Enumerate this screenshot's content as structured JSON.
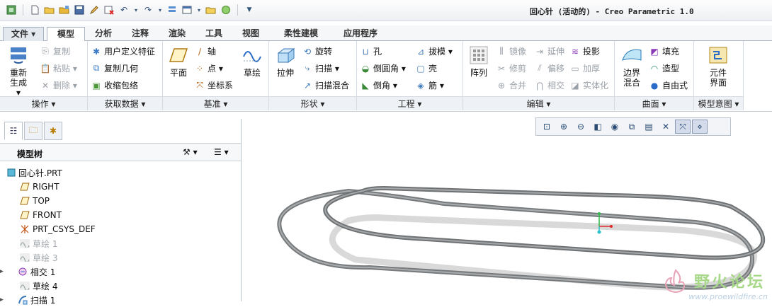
{
  "window": {
    "title": "回心针 (活动的) - Creo Parametric 1.0"
  },
  "quick_access": [
    "app-icon",
    "new-icon",
    "open-icon",
    "open-folder-icon",
    "save-icon",
    "edit-icon",
    "close-window-icon",
    "undo-icon",
    "redo-icon",
    "regenerate-icon",
    "windows-icon",
    "folder-icon",
    "sphere-icon",
    "customize-icon"
  ],
  "tabs": [
    {
      "label": "文件 ▾"
    },
    {
      "label": "模型"
    },
    {
      "label": "分析"
    },
    {
      "label": "注释"
    },
    {
      "label": "渲染"
    },
    {
      "label": "工具"
    },
    {
      "label": "视图"
    },
    {
      "label": "柔性建模"
    },
    {
      "label": "应用程序"
    }
  ],
  "ribbon": {
    "ops": {
      "regen": "重新生成 ▾",
      "copy": "复制",
      "paste": "粘贴 ▾",
      "delete": "删除 ▾",
      "label": "操作 ▾"
    },
    "getdata": {
      "udf": "用户定义特征",
      "copygeom": "复制几何",
      "shrink": "收缩包络",
      "label": "获取数据 ▾"
    },
    "datum": {
      "plane": "平面",
      "axis": "轴",
      "point": "点 ▾",
      "csys": "坐标系",
      "sketch": "草绘",
      "label": "基准 ▾"
    },
    "shape": {
      "extrude": "拉伸",
      "revolve": "旋转",
      "sweep": "扫描 ▾",
      "sweepblend": "扫描混合",
      "label": "形状 ▾"
    },
    "eng": {
      "hole": "孔",
      "round": "倒圆角 ▾",
      "chamfer": "倒角 ▾",
      "draft": "拔模 ▾",
      "shell": "壳",
      "rib": "筋 ▾",
      "label": "工程 ▾"
    },
    "edit": {
      "pattern": "阵列",
      "mirror": "镜像",
      "trim": "修剪",
      "merge": "合并",
      "extend": "延伸",
      "offset": "偏移",
      "intersect": "相交",
      "project": "投影",
      "thicken": "加厚",
      "solidify": "实体化",
      "label": "编辑 ▾"
    },
    "surface": {
      "boundary": "边界混合",
      "fill": "填充",
      "style": "造型",
      "freestyle": "自由式",
      "label": "曲面 ▾"
    },
    "intent": {
      "component": "元件界面",
      "label": "模型意图 ▾"
    }
  },
  "view_toolbar": [
    "refit-icon",
    "zoom-in-icon",
    "zoom-out-icon",
    "repaint-icon",
    "display-style-icon",
    "saved-views-icon",
    "view-manager-icon",
    "datum-display-icon",
    "spin-center-icon",
    "annotation-display-icon"
  ],
  "panel": {
    "tabs": [
      "model-tree-tab",
      "layer-tab",
      "favorites-tab"
    ],
    "tree_title": "模型树",
    "items": [
      {
        "label": "回心针.PRT",
        "icon": "part-icon",
        "expand": "",
        "state": "normal"
      },
      {
        "label": "RIGHT",
        "icon": "plane-icon",
        "expand": "",
        "state": "normal"
      },
      {
        "label": "TOP",
        "icon": "plane-icon",
        "expand": "",
        "state": "normal"
      },
      {
        "label": "FRONT",
        "icon": "plane-icon",
        "expand": "",
        "state": "normal"
      },
      {
        "label": "PRT_CSYS_DEF",
        "icon": "csys-icon",
        "expand": "",
        "state": "normal"
      },
      {
        "label": "草绘 1",
        "icon": "sketch-icon",
        "expand": "",
        "state": "hidden"
      },
      {
        "label": "草绘 3",
        "icon": "sketch-icon",
        "expand": "",
        "state": "hidden"
      },
      {
        "label": "相交 1",
        "icon": "intersect-icon",
        "expand": "▶",
        "state": "normal"
      },
      {
        "label": "草绘 4",
        "icon": "sketch-icon",
        "expand": "",
        "state": "normal"
      },
      {
        "label": "扫描 1",
        "icon": "sweep-icon",
        "expand": "▶",
        "state": "normal"
      }
    ]
  },
  "watermark": {
    "text": "野火论坛",
    "url": "www.proewildfire.cn"
  },
  "colors": {
    "accent": "#2f5e9e",
    "model": "#7e8082",
    "ghost": "#d8d8d8",
    "axis_x": "#e0282b",
    "axis_y": "#2fb84a",
    "axis_z": "#29c0c9"
  }
}
